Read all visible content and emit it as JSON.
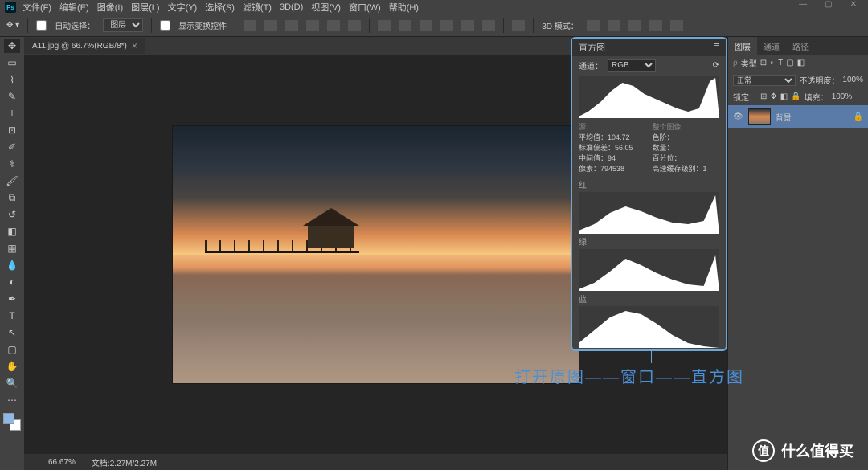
{
  "menu": [
    "文件(F)",
    "编辑(E)",
    "图像(I)",
    "图层(L)",
    "文字(Y)",
    "选择(S)",
    "滤镜(T)",
    "3D(D)",
    "视图(V)",
    "窗口(W)",
    "帮助(H)"
  ],
  "options": {
    "auto_select": "自动选择：",
    "auto_select_value": "图层",
    "show_transform": "显示变换控件",
    "mode3d": "3D 模式："
  },
  "document": {
    "tab_title": "A11.jpg @ 66.7%(RGB/8*)",
    "zoom": "66.67%",
    "docsize": "文档:2.27M/2.27M"
  },
  "histogram": {
    "title": "直方图",
    "channel_label": "通道：",
    "channel_value": "RGB",
    "source_label": "源：",
    "source_value": "整个图像",
    "stats": {
      "mean_label": "平均值：",
      "mean": "104.72",
      "std_label": "标准偏差：",
      "std": "56.05",
      "median_label": "中间值：",
      "median": "94",
      "pixels_label": "像素：",
      "pixels": "794538",
      "level_label": "色阶：",
      "count_label": "数量：",
      "percentile_label": "百分位：",
      "cache_label": "高速缓存级别：",
      "cache": "1"
    },
    "channels": {
      "r": "红",
      "g": "绿",
      "b": "蓝"
    }
  },
  "right_panel": {
    "tabs": [
      "图层",
      "通道",
      "路径"
    ],
    "kind": "类型",
    "blend": "正常",
    "opacity_label": "不透明度：",
    "opacity": "100%",
    "lock_label": "锁定：",
    "fill_label": "填充：",
    "fill": "100%",
    "layer_name": "背景"
  },
  "annotation": "打开原图——窗口——直方图",
  "watermark": {
    "brand": "值",
    "text": "什么值得买"
  },
  "chart_data": [
    {
      "type": "area",
      "title": "RGB",
      "x": [
        0,
        20,
        40,
        60,
        80,
        100,
        120,
        140,
        160,
        180,
        200,
        220,
        240,
        255
      ],
      "y": [
        2,
        8,
        22,
        38,
        48,
        42,
        30,
        22,
        18,
        12,
        8,
        6,
        10,
        58
      ],
      "fill": "#ffffff"
    },
    {
      "type": "area",
      "title": "红",
      "x": [
        0,
        30,
        60,
        90,
        120,
        150,
        180,
        210,
        240,
        255
      ],
      "y": [
        4,
        14,
        30,
        36,
        26,
        18,
        12,
        10,
        14,
        60
      ],
      "fill": "#ffffff"
    },
    {
      "type": "area",
      "title": "绿",
      "x": [
        0,
        30,
        60,
        90,
        120,
        150,
        180,
        210,
        240,
        255
      ],
      "y": [
        2,
        10,
        26,
        42,
        34,
        22,
        14,
        8,
        6,
        48
      ],
      "fill": "#ffffff"
    },
    {
      "type": "area",
      "title": "蓝",
      "x": [
        0,
        30,
        60,
        90,
        120,
        150,
        180,
        210,
        240,
        255
      ],
      "y": [
        6,
        22,
        40,
        50,
        44,
        30,
        16,
        6,
        2,
        2
      ],
      "fill": "#ffffff"
    }
  ]
}
